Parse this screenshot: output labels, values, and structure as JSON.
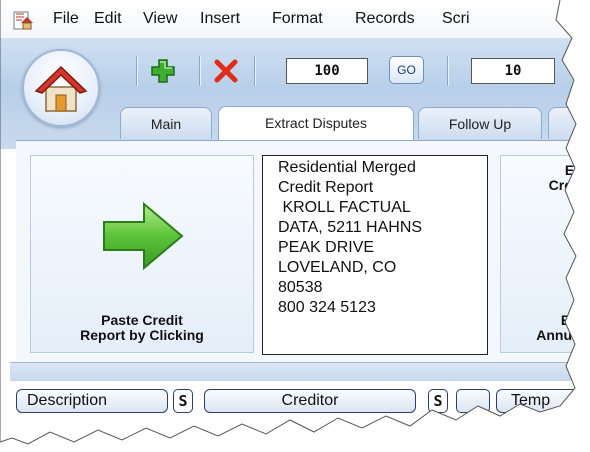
{
  "menu": {
    "items": [
      "File",
      "Edit",
      "View",
      "Insert",
      "Format",
      "Records",
      "Scri"
    ]
  },
  "toolbar": {
    "record_number": "100",
    "go_label": "GO",
    "record_count": "10",
    "icons": [
      "home-icon",
      "plus-icon",
      "delete-x-icon"
    ]
  },
  "tabs": [
    {
      "label": "Main",
      "active": false
    },
    {
      "label": "Extract Disputes",
      "active": true
    },
    {
      "label": "Follow Up",
      "active": false
    }
  ],
  "content": {
    "paste_label_line1": "Paste Credit",
    "paste_label_line2": "Report by Clicking",
    "report_lines": [
      "Residential Merged",
      "Credit Report",
      " KROLL FACTUAL",
      "DATA, 5211 HAHNS",
      "PEAK DRIVE",
      "LOVELAND, CO",
      "80538",
      "800 324 5123"
    ],
    "right_top_line1": "Ex",
    "right_top_line2": "Cre",
    "right_bottom_line1": "Ex",
    "right_bottom_line2": "Annu"
  },
  "columns": {
    "description": "Description",
    "s1": "S",
    "creditor": "Creditor",
    "s2": "S",
    "template": "Temp"
  },
  "colors": {
    "band": "#b8cfe9",
    "arrow_green": "#5cc33a",
    "delete_red": "#e22a1a",
    "plus_green": "#33a02c"
  }
}
